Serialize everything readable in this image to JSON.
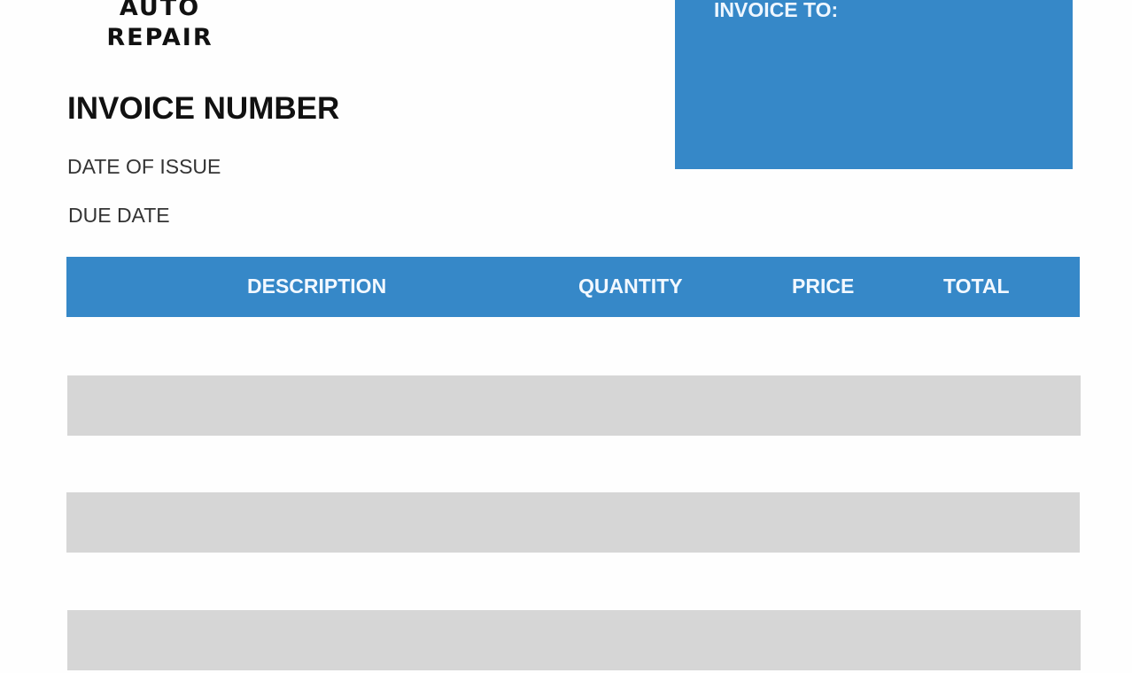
{
  "logo": {
    "line1": "AUTO",
    "line2": "REPAIR"
  },
  "invoice_number_label": "INVOICE NUMBER",
  "date_of_issue_label": "DATE OF ISSUE",
  "due_date_label": "DUE DATE",
  "invoice_to_label": "INVOICE TO:",
  "table": {
    "headers": [
      "DESCRIPTION",
      "QUANTITY",
      "PRICE",
      "TOTAL"
    ],
    "rows": [],
    "accent_color": "#3688c8",
    "stripe_color": "#d6d6d6"
  }
}
